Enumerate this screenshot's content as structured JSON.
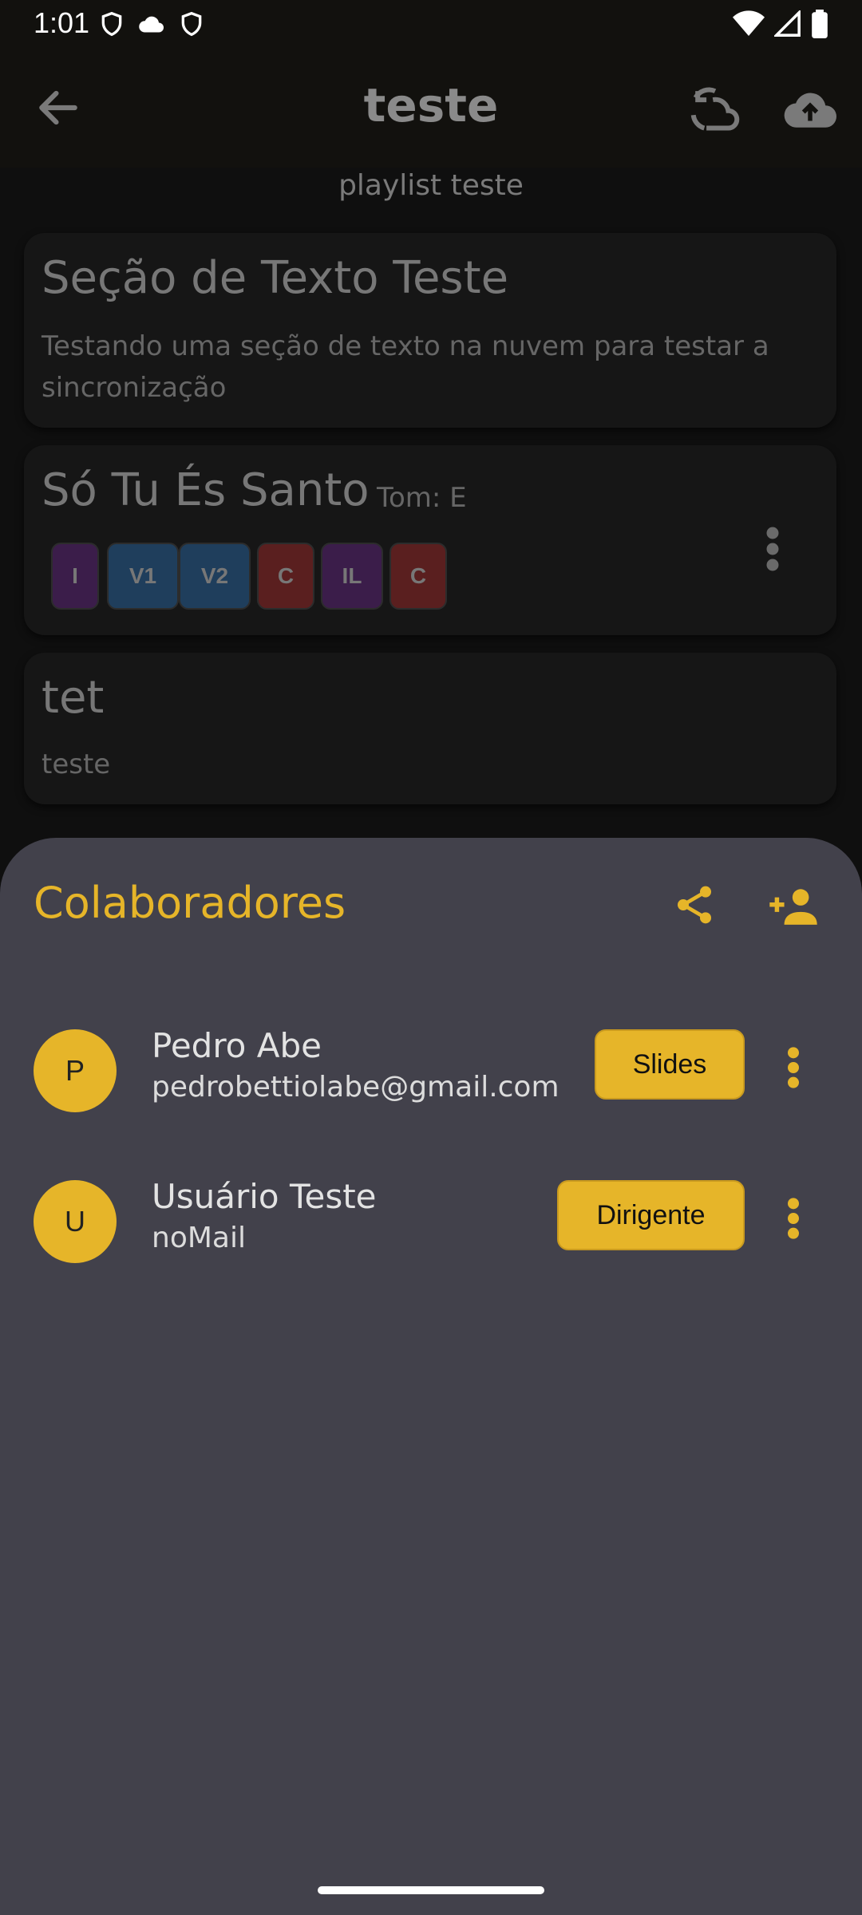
{
  "status": {
    "time": "1:01"
  },
  "appbar": {
    "title": "teste"
  },
  "subtitle": "playlist teste",
  "cards": [
    {
      "title": "Seção de Texto Teste",
      "text": "Testando uma seção de texto na nuvem para testar a sincronização"
    },
    {
      "title": "Só Tu És Santo",
      "tom": "Tom: E",
      "chips": [
        "I",
        "V1",
        "V2",
        "C",
        "IL",
        "C"
      ]
    },
    {
      "title": "tet",
      "text": "teste"
    }
  ],
  "sheet": {
    "title": "Colaboradores",
    "collaborators": [
      {
        "initial": "P",
        "name": "Pedro Abe",
        "email": "pedrobettiolabe@gmail.com",
        "role": "Slides"
      },
      {
        "initial": "U",
        "name": "Usuário Teste",
        "email": "noMail",
        "role": "Dirigente"
      }
    ]
  },
  "colors": {
    "accent": "#e6b529",
    "sheet_bg": "#42414b",
    "chip_intro": "#3b1d4a",
    "chip_verse": "#1f3e5c",
    "chip_chorus": "#5a1f1f"
  }
}
